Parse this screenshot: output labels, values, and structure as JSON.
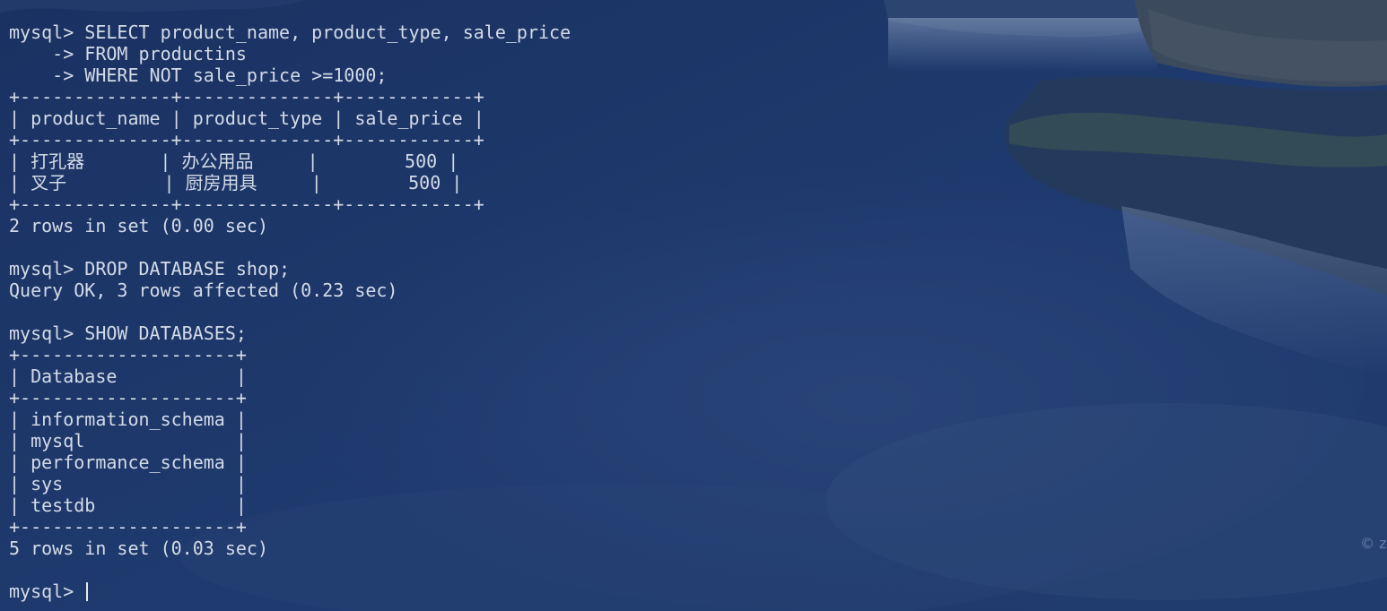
{
  "terminal": {
    "lines": [
      "mysql> SELECT product_name, product_type, sale_price",
      "    -> FROM productins",
      "    -> WHERE NOT sale_price >=1000;",
      "+--------------+--------------+------------+",
      "| product_name | product_type | sale_price |",
      "+--------------+--------------+------------+",
      "| 打孔器       | 办公用品     |        500 |",
      "| 叉子         | 厨房用具     |        500 |",
      "+--------------+--------------+------------+",
      "2 rows in set (0.00 sec)",
      "",
      "mysql> DROP DATABASE shop;",
      "Query OK, 3 rows affected (0.23 sec)",
      "",
      "mysql> SHOW DATABASES;",
      "+--------------------+",
      "| Database           |",
      "+--------------------+",
      "| information_schema |",
      "| mysql              |",
      "| performance_schema |",
      "| sys                |",
      "| testdb             |",
      "+--------------------+",
      "5 rows in set (0.03 sec)",
      "",
      "mysql> "
    ]
  },
  "watermark": {
    "text": "© z"
  },
  "colors": {
    "text": "#d4dbe8",
    "background": "#1d3566"
  }
}
